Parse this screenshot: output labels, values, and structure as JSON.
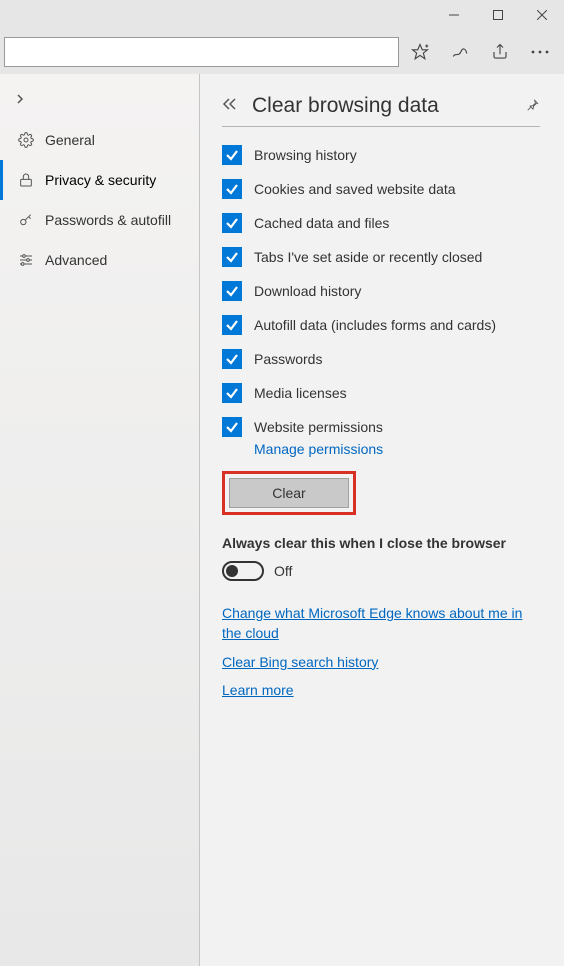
{
  "toolbar": {
    "address_value": ""
  },
  "sidebar": {
    "items": [
      {
        "icon": "gear",
        "label": "General"
      },
      {
        "icon": "lock",
        "label": "Privacy & security"
      },
      {
        "icon": "key",
        "label": "Passwords & autofill"
      },
      {
        "icon": "sliders",
        "label": "Advanced"
      }
    ],
    "active_index": 1
  },
  "panel": {
    "title": "Clear browsing data",
    "checks": [
      "Browsing history",
      "Cookies and saved website data",
      "Cached data and files",
      "Tabs I've set aside or recently closed",
      "Download history",
      "Autofill data (includes forms and cards)",
      "Passwords",
      "Media licenses",
      "Website permissions"
    ],
    "manage_link": "Manage permissions",
    "clear_button": "Clear",
    "always_clear_heading": "Always clear this when I close the browser",
    "toggle_state_label": "Off",
    "links": [
      "Change what Microsoft Edge knows about me in the cloud",
      "Clear Bing search history",
      "Learn more"
    ]
  }
}
